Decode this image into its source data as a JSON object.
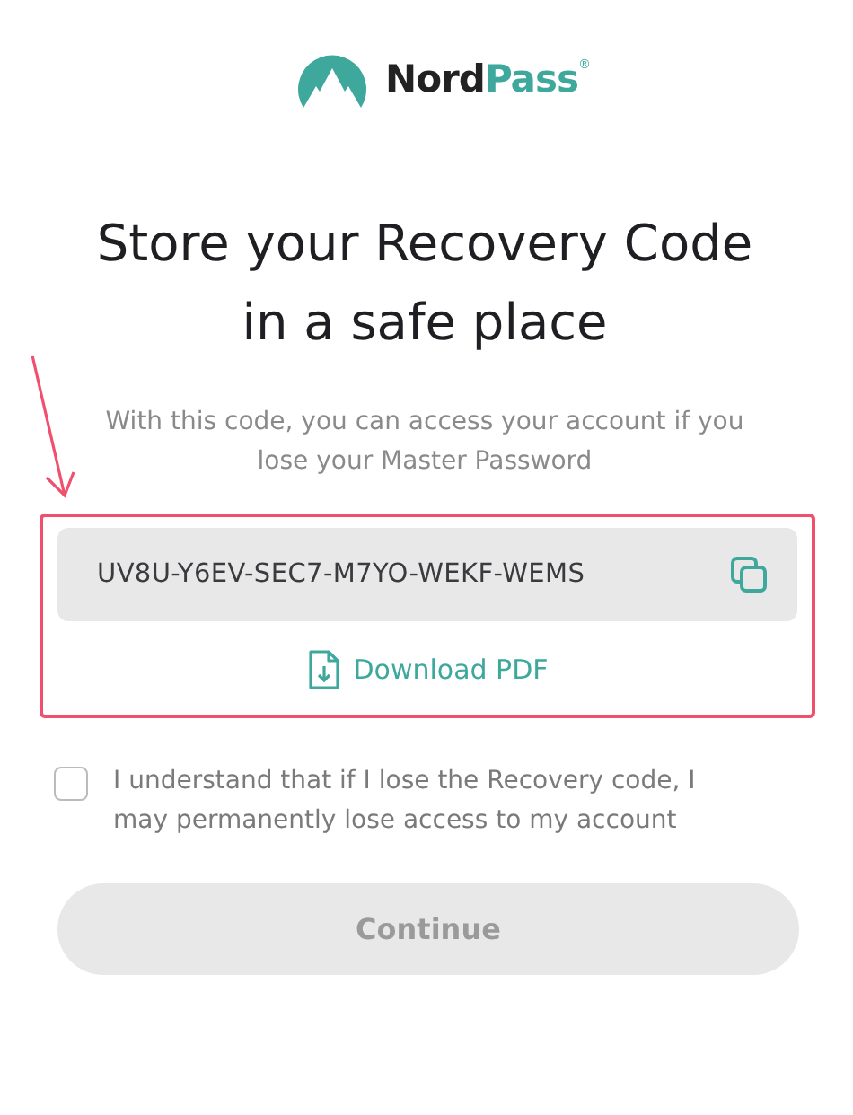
{
  "logo": {
    "text": "Nord",
    "accent": "Pass",
    "mark": "®"
  },
  "title": "Store your Recovery Code in a safe place",
  "subtitle": "With this code, you can access your account if you lose your Master Password",
  "recovery_code": "UV8U-Y6EV-SEC7-M7YO-WEKF-WEMS",
  "download_link": "Download PDF",
  "consent": {
    "label": "I understand that if I lose the Recovery code, I may permanently lose access to my account",
    "checked": false
  },
  "continue_button": {
    "label": "Continue",
    "disabled": true
  }
}
